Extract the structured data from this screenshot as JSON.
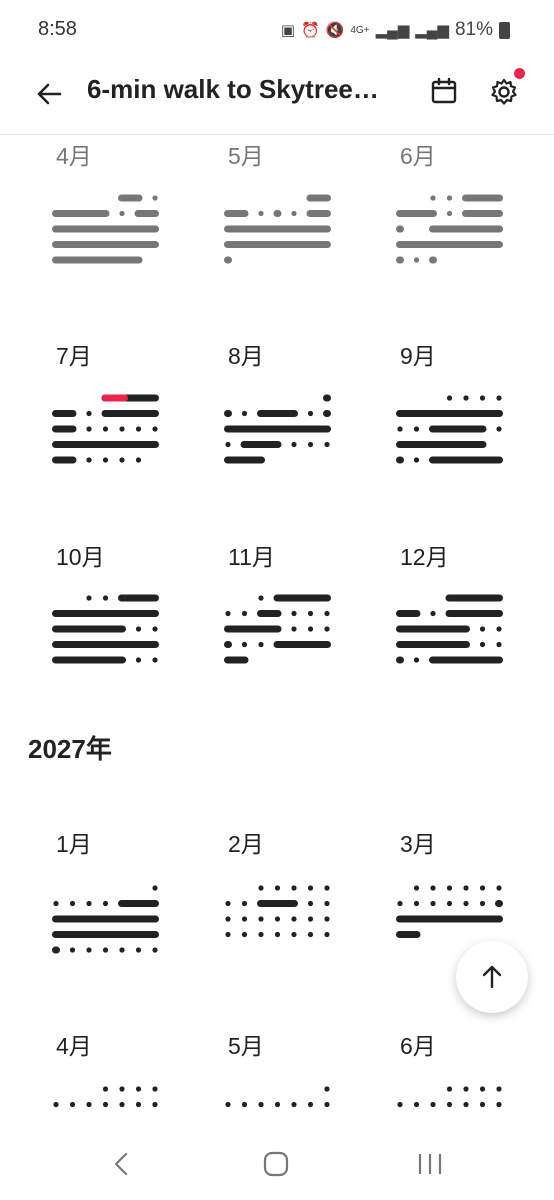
{
  "status_bar": {
    "time": "8:58",
    "network": "4G+",
    "battery": "81%"
  },
  "app_bar": {
    "title": "6-min walk to Skytree…"
  },
  "colors": {
    "past": "#777777",
    "current": "#222222",
    "highlight": "#e8264d",
    "badge": "#e8264d"
  },
  "sections": [
    {
      "year": "",
      "months": [
        {
          "label": "4月",
          "state": "past"
        },
        {
          "label": "5月",
          "state": "past"
        },
        {
          "label": "6月",
          "state": "past"
        },
        {
          "label": "7月",
          "state": "current"
        },
        {
          "label": "8月",
          "state": "current"
        },
        {
          "label": "9月",
          "state": "current"
        },
        {
          "label": "10月",
          "state": "current"
        },
        {
          "label": "11月",
          "state": "current"
        },
        {
          "label": "12月",
          "state": "current"
        }
      ]
    },
    {
      "year": "2027年",
      "months": [
        {
          "label": "1月",
          "state": "current"
        },
        {
          "label": "2月",
          "state": "current"
        },
        {
          "label": "3月",
          "state": "current"
        },
        {
          "label": "4月",
          "state": "current"
        },
        {
          "label": "5月",
          "state": "current"
        },
        {
          "label": "6月",
          "state": "current"
        }
      ]
    }
  ],
  "icons": {
    "back": "arrow-left-icon",
    "calendar": "calendar-icon",
    "settings": "gear-icon",
    "scroll_top": "arrow-up-icon"
  }
}
